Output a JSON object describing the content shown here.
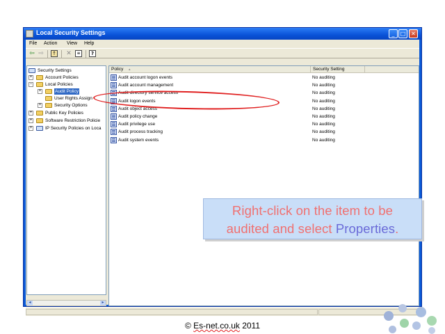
{
  "window": {
    "title": "Local Security Settings",
    "controls": {
      "minimize": "_",
      "maximize": "□",
      "close": "✕"
    }
  },
  "menu": [
    "File",
    "Action",
    "View",
    "Help"
  ],
  "toolbar": {
    "icons": [
      "back-arrow-icon",
      "forward-arrow-icon",
      "up-folder-icon",
      "delete-icon",
      "properties-icon",
      "help-icon"
    ]
  },
  "tree": {
    "root": "Security Settings",
    "items": [
      {
        "label": "Account Policies",
        "expander": "+"
      },
      {
        "label": "Local Policies",
        "expander": "−"
      },
      {
        "label": "Audit Policy",
        "expander": ""
      },
      {
        "label": "User Rights Assign",
        "expander": "+"
      },
      {
        "label": "Security Options",
        "expander": "+"
      },
      {
        "label": "Public Key Policies",
        "expander": "+"
      },
      {
        "label": "Software Restriction Policie",
        "expander": "+"
      },
      {
        "label": "IP Security Policies on Loca",
        "expander": "+"
      }
    ]
  },
  "list": {
    "columns": {
      "policy": "Policy",
      "setting": "Security Setting",
      "sort_indicator": "▴"
    },
    "rows": [
      {
        "policy": "Audit account logon events",
        "setting": "No auditing"
      },
      {
        "policy": "Audit account management",
        "setting": "No auditing"
      },
      {
        "policy": "Audit directory service access",
        "setting": "No auditing"
      },
      {
        "policy": "Audit logon events",
        "setting": "No auditing"
      },
      {
        "policy": "Audit object access",
        "setting": "No auditing"
      },
      {
        "policy": "Audit policy change",
        "setting": "No auditing"
      },
      {
        "policy": "Audit privilege use",
        "setting": "No auditing"
      },
      {
        "policy": "Audit process tracking",
        "setting": "No auditing"
      },
      {
        "policy": "Audit system events",
        "setting": "No auditing"
      }
    ]
  },
  "callout": {
    "line1": "Right-click on the item to be",
    "line2_before": "audited and select ",
    "line2_highlight": "Properties",
    "line2_after": "."
  },
  "footer": {
    "prefix": "© ",
    "brand": "Es-net.co.uk",
    "suffix": " 2011"
  },
  "colors": {
    "titlebar": "#0a53d8",
    "selection": "#316ac5",
    "callout_bg": "#c9def8",
    "callout_text": "#f07070",
    "callout_highlight": "#6a6ad8",
    "annotation": "#e02020"
  }
}
